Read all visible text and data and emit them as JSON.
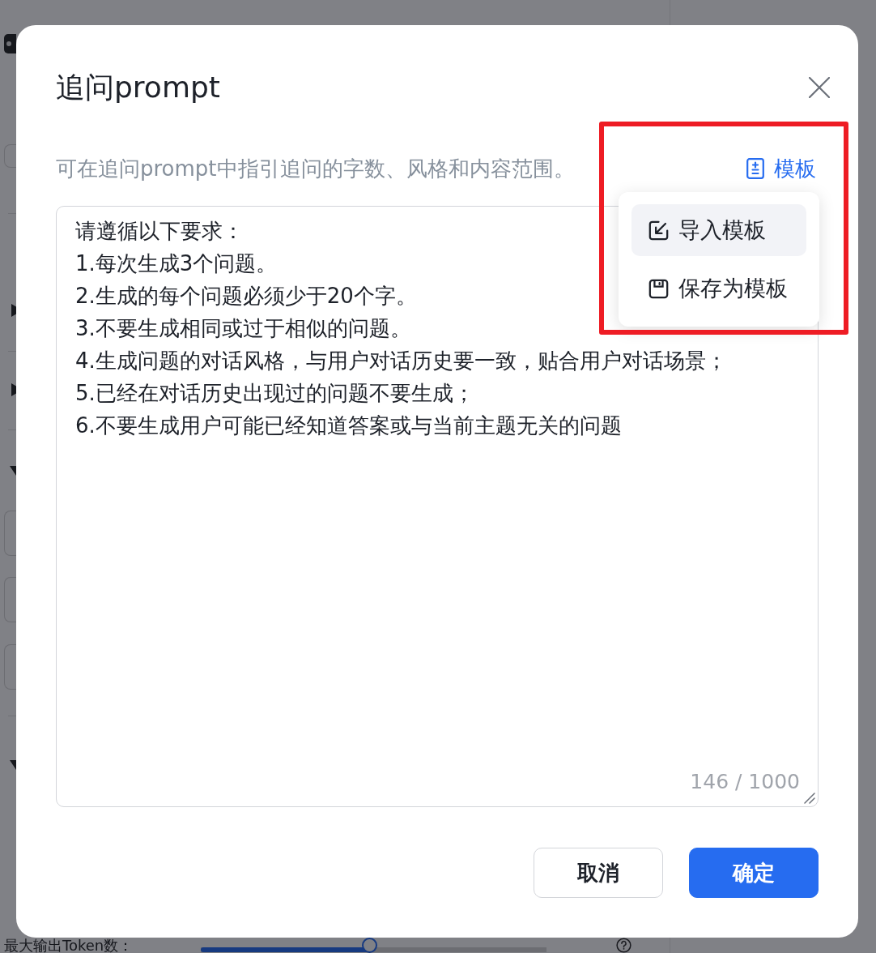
{
  "background_page": {
    "token_field": {
      "label": "最大输出Token数：",
      "slider": {
        "level": 0.49
      }
    }
  },
  "dialog": {
    "title": "追问prompt",
    "description": "可在追问prompt中指引追问的字数、风格和内容范围。",
    "template_button": {
      "label": "模板"
    },
    "template_menu": {
      "items": [
        {
          "kind": "import",
          "label": "导入模板",
          "selected": true
        },
        {
          "kind": "save",
          "label": "保存为模板",
          "selected": false
        }
      ]
    },
    "prompt": {
      "lines": [
        "请遵循以下要求：",
        "1.每次生成3个问题。",
        "2.生成的每个问题必须少于20个字。",
        "3.不要生成相同或过于相似的问题。",
        "4.生成问题的对话风格，与用户对话历史要一致，贴合用户对话场景；",
        "5.已经在对话历史出现过的问题不要生成；",
        "6.不要生成用户可能已经知道答案或与当前主题无关的问题"
      ],
      "counter": "146 / 1000"
    },
    "buttons": [
      {
        "kind": "secondary",
        "label": "取消"
      },
      {
        "kind": "primary",
        "label": "确定"
      }
    ]
  }
}
